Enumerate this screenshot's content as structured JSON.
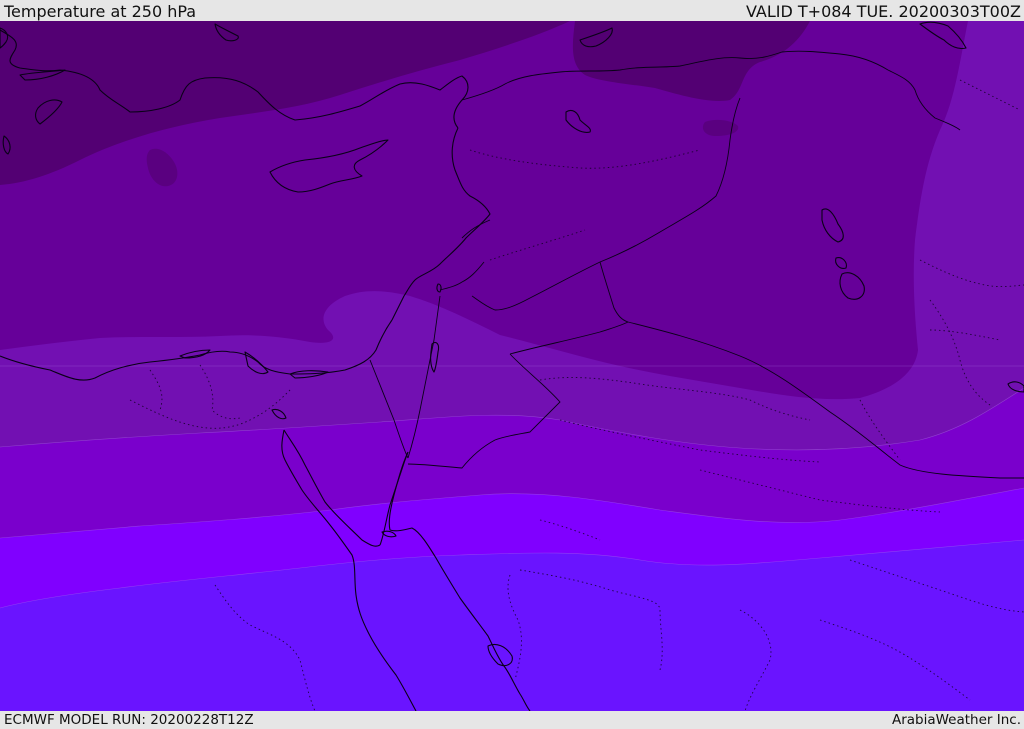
{
  "header": {
    "title": "Temperature at 250 hPa",
    "valid_time": "VALID T+084 TUE. 20200303T00Z"
  },
  "footer": {
    "model_run": "ECMWF MODEL RUN: 20200228T12Z",
    "credit": "ArabiaWeather Inc."
  },
  "map": {
    "field": "temperature",
    "level_hpa": 250,
    "band_colors": [
      "#530073",
      "#660099",
      "#7210b2",
      "#7a00cc",
      "#8000ff",
      "#6a14ff"
    ]
  }
}
